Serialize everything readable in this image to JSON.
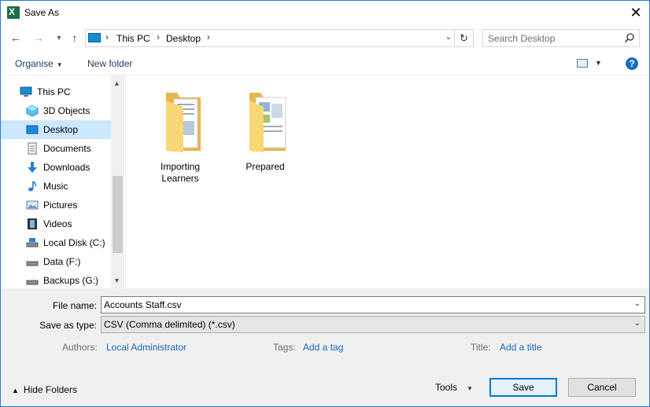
{
  "window": {
    "title": "Save As",
    "close_glyph": "✕"
  },
  "nav": {
    "address": [
      "This PC",
      "Desktop"
    ],
    "search_placeholder": "Search Desktop"
  },
  "commands": {
    "organise": "Organise",
    "new_folder": "New folder",
    "help": "?"
  },
  "sidebar": {
    "items": [
      {
        "label": "This PC",
        "icon": "computer-icon"
      },
      {
        "label": "3D Objects",
        "icon": "cube-icon"
      },
      {
        "label": "Desktop",
        "icon": "desktop-icon",
        "selected": true
      },
      {
        "label": "Documents",
        "icon": "document-icon"
      },
      {
        "label": "Downloads",
        "icon": "download-arrow-icon"
      },
      {
        "label": "Music",
        "icon": "music-note-icon"
      },
      {
        "label": "Pictures",
        "icon": "picture-icon"
      },
      {
        "label": "Videos",
        "icon": "film-icon"
      },
      {
        "label": "Local Disk (C:)",
        "icon": "drive-icon"
      },
      {
        "label": "Data (F:)",
        "icon": "drive-icon"
      },
      {
        "label": "Backups (G:)",
        "icon": "drive-icon"
      }
    ]
  },
  "content": {
    "folders": [
      {
        "label": "Importing Learners",
        "icon": "folder-icon"
      },
      {
        "label": "Prepared",
        "icon": "folder-icon"
      }
    ]
  },
  "form": {
    "file_name_label": "File name:",
    "file_name_value": "Accounts Staff.csv",
    "save_type_label": "Save as type:",
    "save_type_value": "CSV (Comma delimited) (*.csv)",
    "authors_label": "Authors:",
    "authors_value": "Local Administrator",
    "tags_label": "Tags:",
    "tags_value": "Add a tag",
    "title_label": "Title:",
    "title_value": "Add a title"
  },
  "footer": {
    "hide_folders": "Hide Folders",
    "tools": "Tools",
    "save": "Save",
    "cancel": "Cancel"
  },
  "colors": {
    "accent": "#0078d7",
    "link": "#1a66b8",
    "selection": "#cce8ff",
    "folder": "#f8d775"
  }
}
